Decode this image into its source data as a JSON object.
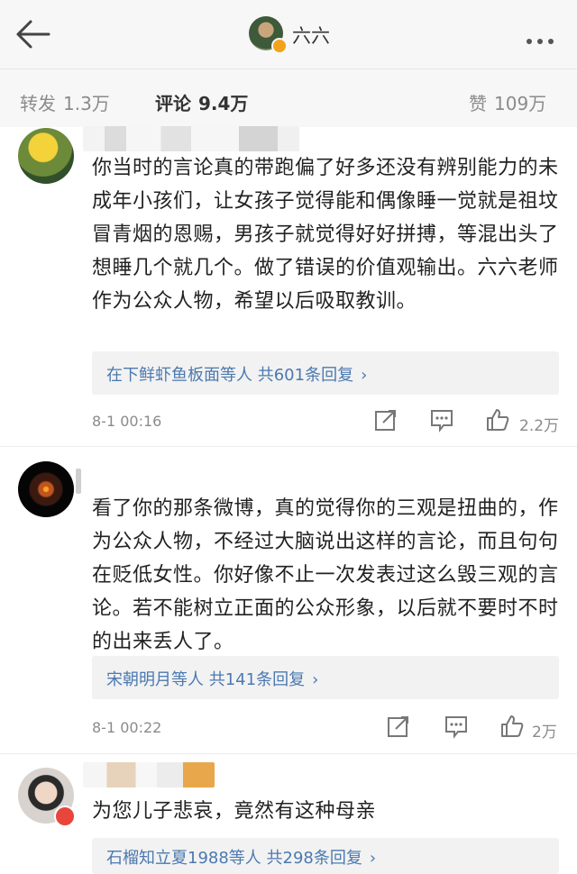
{
  "header": {
    "title": "六六",
    "back_icon": "arrow-left-icon",
    "more_icon": "more-dots-icon"
  },
  "tabs": [
    {
      "label": "转发",
      "count": "1.3万",
      "active": false
    },
    {
      "label": "评论",
      "count": "9.4万",
      "active": true
    },
    {
      "label": "赞",
      "count": "109万",
      "active": false
    }
  ],
  "comments": [
    {
      "text": "你当时的言论真的带跑偏了好多还没有辨别能力的未成年小孩们，让女孩子觉得能和偶像睡一觉就是祖坟冒青烟的恩赐，男孩子就觉得好好拼搏，等混出头了想睡几个就几个。做了错误的价值观输出。六六老师作为公众人物，希望以后吸取教训。",
      "reply_summary": "在下鲜虾鱼板面等人  共601条回复",
      "time": "8-1 00:16",
      "likes": "2.2万"
    },
    {
      "text": "看了你的那条微博，真的觉得你的三观是扭曲的，作为公众人物，不经过大脑说出这样的言论，而且句句在贬低女性。你好像不止一次发表过这么毁三观的言论。若不能树立正面的公众形象，以后就不要时不时的出来丢人了。",
      "reply_summary": "宋朝明月等人  共141条回复",
      "time": "8-1 00:22",
      "likes": "2万"
    },
    {
      "text": "为您儿子悲哀，竟然有这种母亲",
      "reply_summary": "石榴知立夏1988等人  共298条回复",
      "time": "",
      "likes": ""
    }
  ],
  "colors": {
    "link": "#4b79b0",
    "muted": "#8b8b8b",
    "header_bg": "#f7f7f7",
    "reply_bg": "#f2f2f2"
  }
}
